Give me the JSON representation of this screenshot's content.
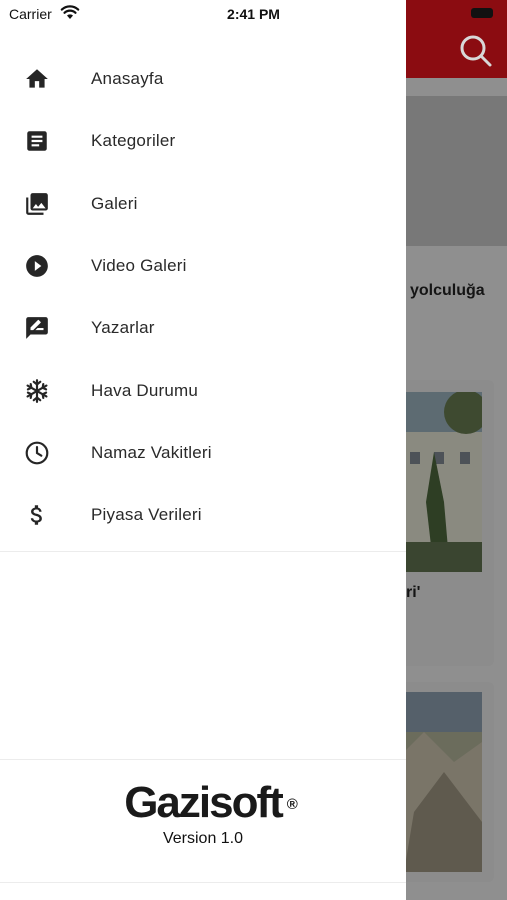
{
  "status_bar": {
    "carrier": "Carrier",
    "time": "2:41 PM"
  },
  "menu": [
    {
      "label": "Anasayfa",
      "icon": "home-icon"
    },
    {
      "label": "Kategoriler",
      "icon": "article-icon"
    },
    {
      "label": "Galeri",
      "icon": "photo-library-icon"
    },
    {
      "label": "Video Galeri",
      "icon": "play-circle-icon"
    },
    {
      "label": "Yazarlar",
      "icon": "rate-review-icon"
    },
    {
      "label": "Hava Durumu",
      "icon": "snowflake-icon"
    },
    {
      "label": "Namaz Vakitleri",
      "icon": "clock-icon"
    },
    {
      "label": "Piyasa Verileri",
      "icon": "dollar-icon"
    }
  ],
  "footer": {
    "brand": "Gazisoft",
    "registered": "®",
    "version": "Version 1.0"
  },
  "background": {
    "headline": "yolculuğa",
    "card_title": "ri'"
  },
  "colors": {
    "brand_red": "#b5121b",
    "icon": "#262626",
    "text": "#2a2a2a"
  }
}
